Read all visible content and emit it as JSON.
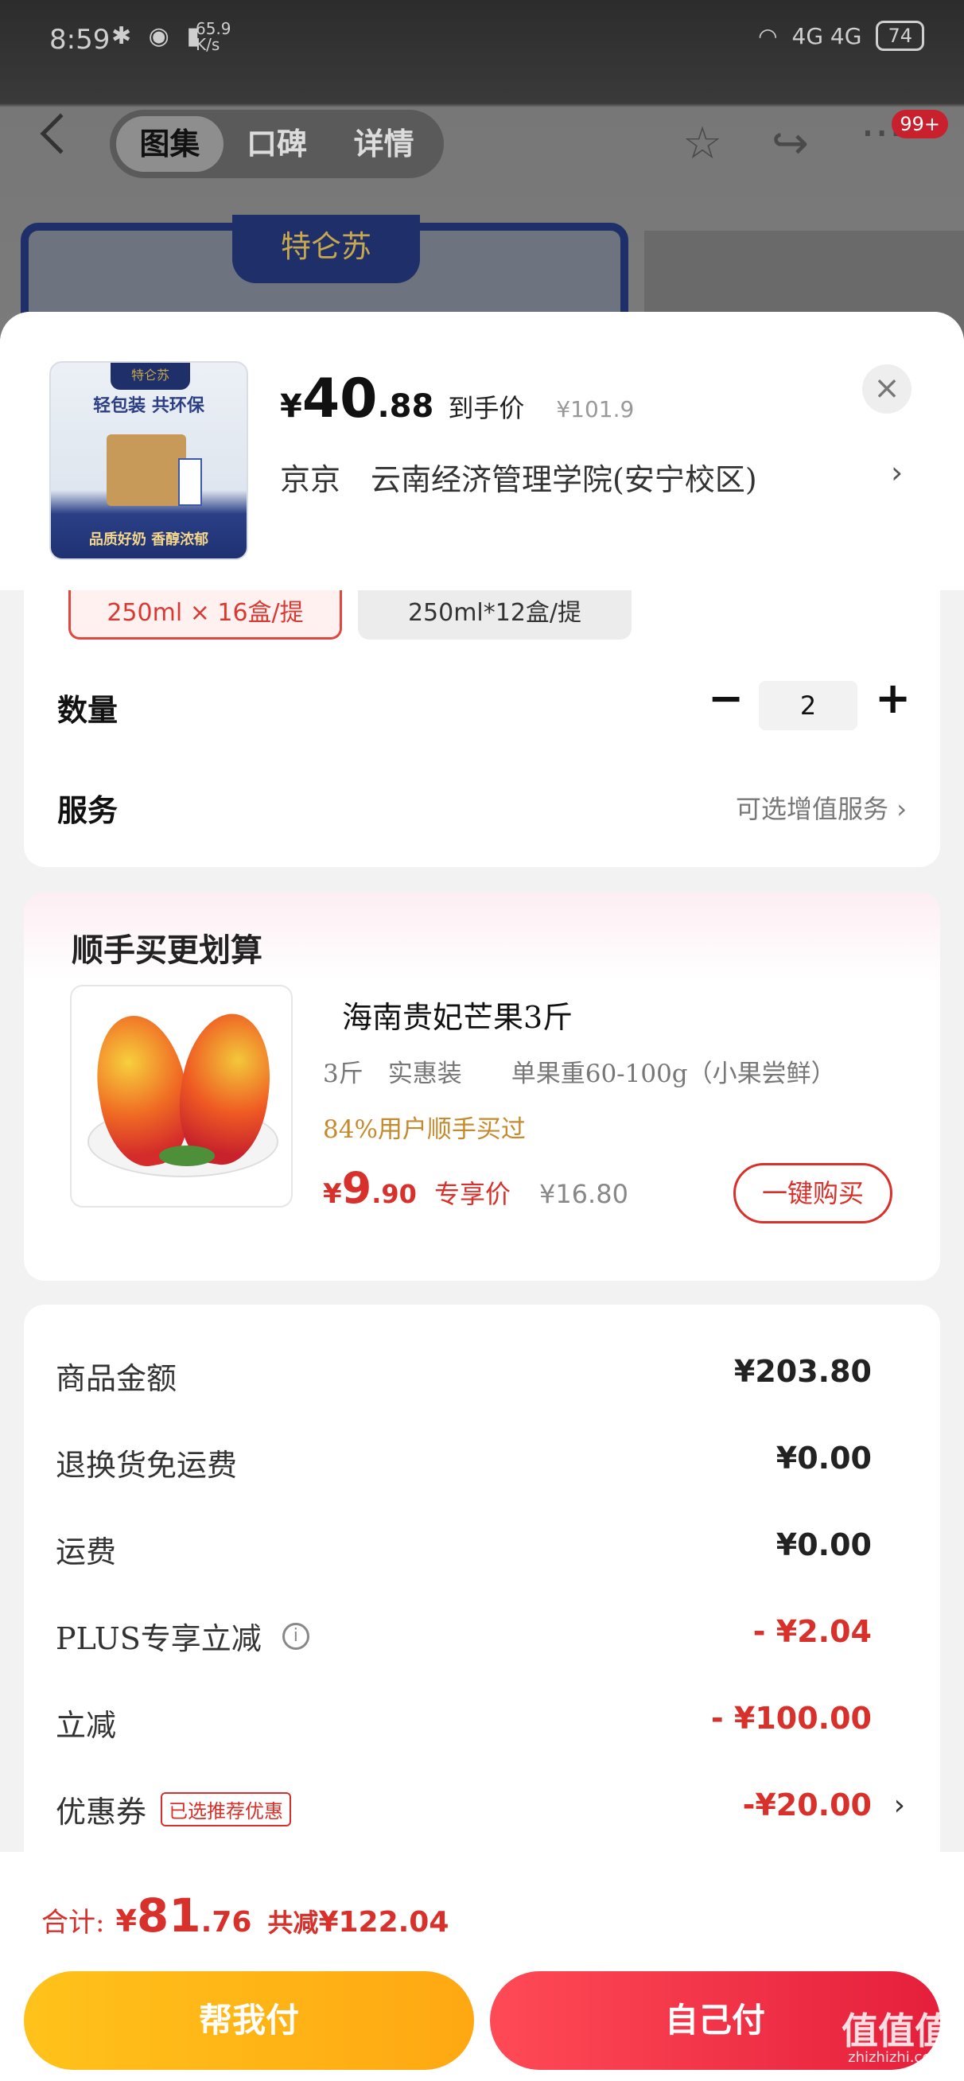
{
  "status_bar": {
    "time": "8:59",
    "icons_left": "✱ ◉ ▮",
    "net_speed_value": "65.9",
    "net_speed_unit": "K/s",
    "signal": "4G 4G",
    "battery": "74"
  },
  "top_nav": {
    "tabs": [
      {
        "label": "图集",
        "active": true
      },
      {
        "label": "口碑",
        "active": false
      },
      {
        "label": "详情",
        "active": false
      }
    ],
    "badge": "99+",
    "banner_logo": "特仑苏"
  },
  "product": {
    "thumb_logo": "特仑苏",
    "thumb_slogan": "轻包装 共环保",
    "thumb_bottom": "品质好奶 香醇浓郁",
    "price_yen": "¥",
    "price_int": "40",
    "price_dec": ".88",
    "price_label": "到手价",
    "original_price": "¥101.9",
    "close": "×",
    "address": "京京　云南经济管理学院(安宁校区)",
    "address_chevron": "›"
  },
  "specs": [
    {
      "label": "250ml × 16盒/提",
      "selected": true
    },
    {
      "label": "250ml*12盒/提",
      "selected": false
    }
  ],
  "quantity": {
    "label": "数量",
    "minus": "−",
    "value": "2",
    "plus": "+"
  },
  "service": {
    "label": "服务",
    "value": "可选增值服务 ›"
  },
  "bundle": {
    "title": "顺手买更划算",
    "name": "海南贵妃芒果3斤",
    "spec": "3斤　实惠装　　单果重60-100g（小果尝鲜）",
    "social": "84%用户顺手买过",
    "price_yen": "¥",
    "price_int": "9",
    "price_dec": ".90",
    "price_label": "专享价",
    "original_price": "¥16.80",
    "buy_label": "一键购买"
  },
  "summary": {
    "rows": [
      {
        "label": "商品金额",
        "value": "¥203.80"
      },
      {
        "label": "退换货免运费",
        "value": "¥0.00"
      },
      {
        "label": "运费",
        "value": "¥0.00"
      },
      {
        "label": "PLUS专享立减",
        "value": "- ¥2.04",
        "info_icon": "i"
      },
      {
        "label": "立减",
        "value": "- ¥100.00"
      },
      {
        "label": "优惠券",
        "value": "-¥20.00",
        "tag": "已选推荐优惠",
        "chevron": "›"
      }
    ]
  },
  "footer": {
    "total_label": "合计:",
    "total_yen": "¥",
    "total_int": "81",
    "total_dec": ".76",
    "save_label": "共减",
    "save_value": "¥122.04",
    "friend_pay": "帮我付",
    "self_pay": "自己付"
  },
  "watermark": {
    "text": "值值值",
    "sub": "zhizhizhi.com"
  },
  "colors": {
    "accent_red": "#d8302a",
    "pay_yellow": "#ffb516",
    "pay_red": "#e9263e"
  }
}
